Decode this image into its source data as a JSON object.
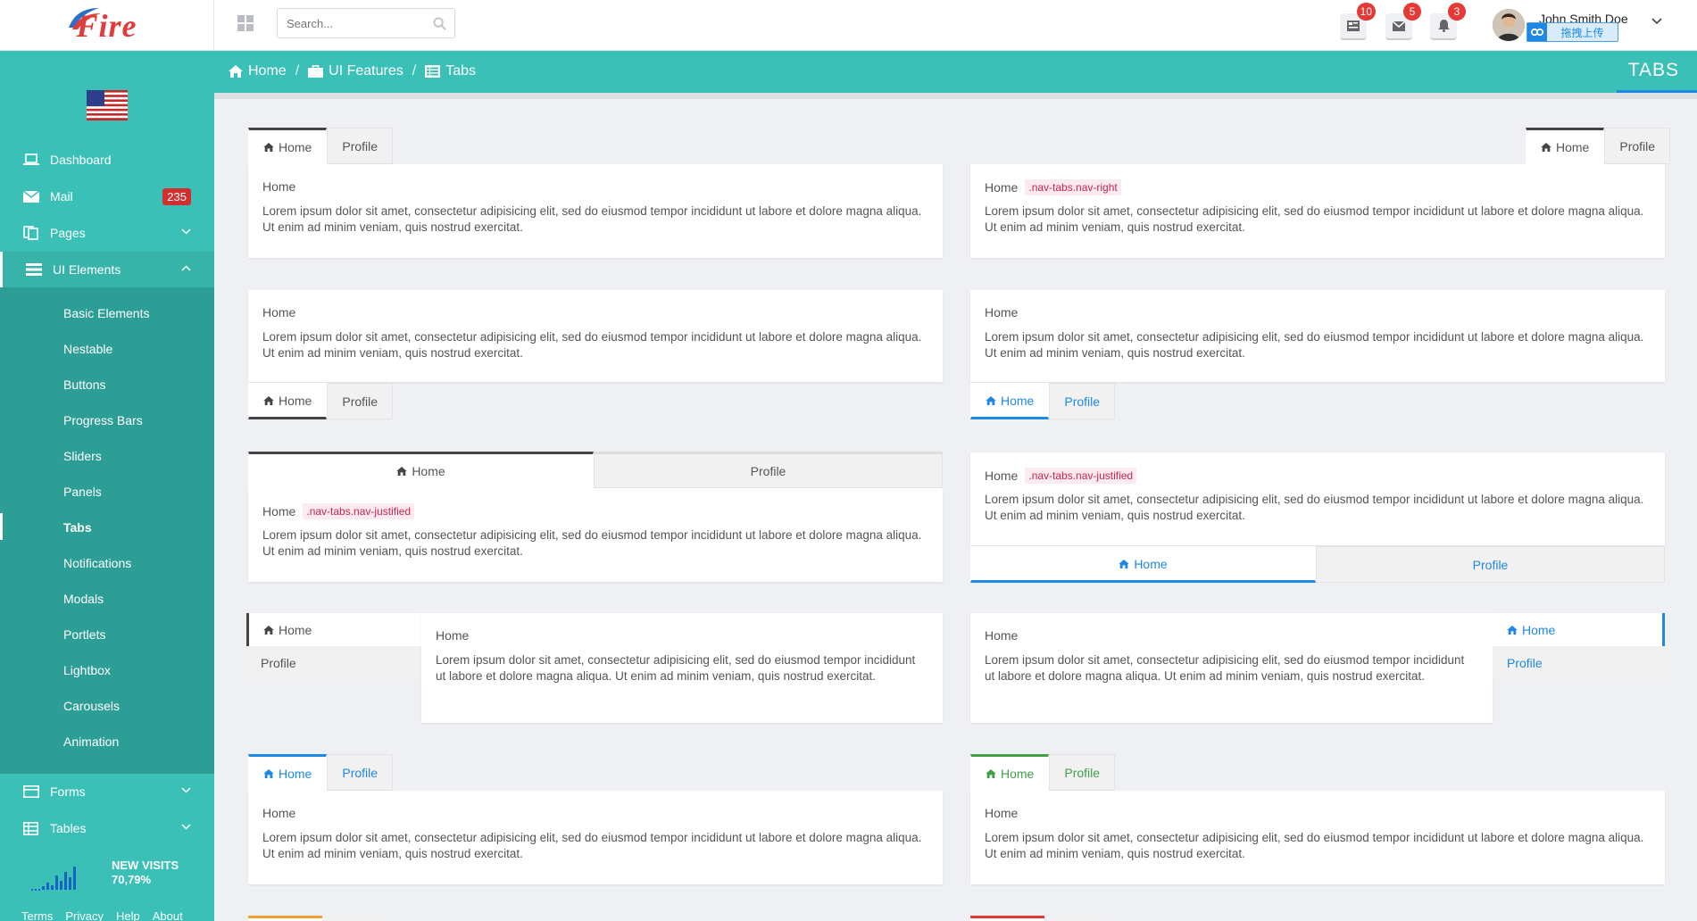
{
  "app": {
    "logo_text": "Fire"
  },
  "search": {
    "placeholder": "Search..."
  },
  "notifications": {
    "tasks_count": "10",
    "mail_count": "5",
    "alerts_count": "3"
  },
  "user": {
    "name": "John Smith Doe",
    "upload_label": "拖拽上传"
  },
  "sidebar": {
    "items": [
      {
        "label": "Dashboard"
      },
      {
        "label": "Mail",
        "badge": "235"
      },
      {
        "label": "Pages"
      },
      {
        "label": "UI Elements"
      },
      {
        "label": "Forms"
      },
      {
        "label": "Tables"
      }
    ],
    "submenu": [
      "Basic Elements",
      "Nestable",
      "Buttons",
      "Progress Bars",
      "Sliders",
      "Panels",
      "Tabs",
      "Notifications",
      "Modals",
      "Portlets",
      "Lightbox",
      "Carousels",
      "Animation"
    ],
    "visits_title": "NEW VISITS",
    "visits_value": "70,79%",
    "footer_links": [
      "Terms",
      "Privacy",
      "Help",
      "About"
    ]
  },
  "breadcrumb": [
    "Home",
    "UI Features",
    "Tabs"
  ],
  "page_title": "TABS",
  "tabs": {
    "home": "Home",
    "profile": "Profile"
  },
  "panel_content": {
    "heading": "Home",
    "text": "Lorem ipsum dolor sit amet, consectetur adipisicing elit, sed do eiusmod tempor incididunt ut labore et dolore magna aliqua. Ut enim ad minim veniam, quis nostrud exercitat.",
    "code_right": ".nav-tabs.nav-right",
    "code_justified": ".nav-tabs.nav-justified"
  },
  "colors": {
    "primary": "#3ac0b6",
    "accent_blue": "#1e88e5",
    "accent_green": "#43a047",
    "accent_orange": "#f0a030",
    "accent_red": "#e53935",
    "badge_red": "#d32f2f"
  }
}
